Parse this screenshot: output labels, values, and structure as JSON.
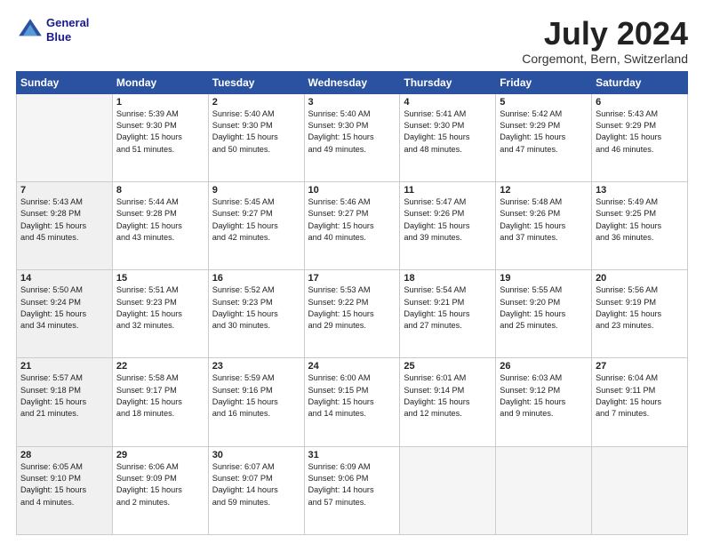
{
  "logo": {
    "line1": "General",
    "line2": "Blue"
  },
  "title": "July 2024",
  "subtitle": "Corgemont, Bern, Switzerland",
  "days_of_week": [
    "Sunday",
    "Monday",
    "Tuesday",
    "Wednesday",
    "Thursday",
    "Friday",
    "Saturday"
  ],
  "weeks": [
    [
      {
        "day": "",
        "info": "",
        "empty": true
      },
      {
        "day": "1",
        "info": "Sunrise: 5:39 AM\nSunset: 9:30 PM\nDaylight: 15 hours\nand 51 minutes."
      },
      {
        "day": "2",
        "info": "Sunrise: 5:40 AM\nSunset: 9:30 PM\nDaylight: 15 hours\nand 50 minutes."
      },
      {
        "day": "3",
        "info": "Sunrise: 5:40 AM\nSunset: 9:30 PM\nDaylight: 15 hours\nand 49 minutes."
      },
      {
        "day": "4",
        "info": "Sunrise: 5:41 AM\nSunset: 9:30 PM\nDaylight: 15 hours\nand 48 minutes."
      },
      {
        "day": "5",
        "info": "Sunrise: 5:42 AM\nSunset: 9:29 PM\nDaylight: 15 hours\nand 47 minutes."
      },
      {
        "day": "6",
        "info": "Sunrise: 5:43 AM\nSunset: 9:29 PM\nDaylight: 15 hours\nand 46 minutes."
      }
    ],
    [
      {
        "day": "7",
        "info": "Sunrise: 5:43 AM\nSunset: 9:28 PM\nDaylight: 15 hours\nand 45 minutes.",
        "shade": true
      },
      {
        "day": "8",
        "info": "Sunrise: 5:44 AM\nSunset: 9:28 PM\nDaylight: 15 hours\nand 43 minutes."
      },
      {
        "day": "9",
        "info": "Sunrise: 5:45 AM\nSunset: 9:27 PM\nDaylight: 15 hours\nand 42 minutes."
      },
      {
        "day": "10",
        "info": "Sunrise: 5:46 AM\nSunset: 9:27 PM\nDaylight: 15 hours\nand 40 minutes."
      },
      {
        "day": "11",
        "info": "Sunrise: 5:47 AM\nSunset: 9:26 PM\nDaylight: 15 hours\nand 39 minutes."
      },
      {
        "day": "12",
        "info": "Sunrise: 5:48 AM\nSunset: 9:26 PM\nDaylight: 15 hours\nand 37 minutes."
      },
      {
        "day": "13",
        "info": "Sunrise: 5:49 AM\nSunset: 9:25 PM\nDaylight: 15 hours\nand 36 minutes."
      }
    ],
    [
      {
        "day": "14",
        "info": "Sunrise: 5:50 AM\nSunset: 9:24 PM\nDaylight: 15 hours\nand 34 minutes.",
        "shade": true
      },
      {
        "day": "15",
        "info": "Sunrise: 5:51 AM\nSunset: 9:23 PM\nDaylight: 15 hours\nand 32 minutes."
      },
      {
        "day": "16",
        "info": "Sunrise: 5:52 AM\nSunset: 9:23 PM\nDaylight: 15 hours\nand 30 minutes."
      },
      {
        "day": "17",
        "info": "Sunrise: 5:53 AM\nSunset: 9:22 PM\nDaylight: 15 hours\nand 29 minutes."
      },
      {
        "day": "18",
        "info": "Sunrise: 5:54 AM\nSunset: 9:21 PM\nDaylight: 15 hours\nand 27 minutes."
      },
      {
        "day": "19",
        "info": "Sunrise: 5:55 AM\nSunset: 9:20 PM\nDaylight: 15 hours\nand 25 minutes."
      },
      {
        "day": "20",
        "info": "Sunrise: 5:56 AM\nSunset: 9:19 PM\nDaylight: 15 hours\nand 23 minutes."
      }
    ],
    [
      {
        "day": "21",
        "info": "Sunrise: 5:57 AM\nSunset: 9:18 PM\nDaylight: 15 hours\nand 21 minutes.",
        "shade": true
      },
      {
        "day": "22",
        "info": "Sunrise: 5:58 AM\nSunset: 9:17 PM\nDaylight: 15 hours\nand 18 minutes."
      },
      {
        "day": "23",
        "info": "Sunrise: 5:59 AM\nSunset: 9:16 PM\nDaylight: 15 hours\nand 16 minutes."
      },
      {
        "day": "24",
        "info": "Sunrise: 6:00 AM\nSunset: 9:15 PM\nDaylight: 15 hours\nand 14 minutes."
      },
      {
        "day": "25",
        "info": "Sunrise: 6:01 AM\nSunset: 9:14 PM\nDaylight: 15 hours\nand 12 minutes."
      },
      {
        "day": "26",
        "info": "Sunrise: 6:03 AM\nSunset: 9:12 PM\nDaylight: 15 hours\nand 9 minutes."
      },
      {
        "day": "27",
        "info": "Sunrise: 6:04 AM\nSunset: 9:11 PM\nDaylight: 15 hours\nand 7 minutes."
      }
    ],
    [
      {
        "day": "28",
        "info": "Sunrise: 6:05 AM\nSunset: 9:10 PM\nDaylight: 15 hours\nand 4 minutes.",
        "shade": true
      },
      {
        "day": "29",
        "info": "Sunrise: 6:06 AM\nSunset: 9:09 PM\nDaylight: 15 hours\nand 2 minutes."
      },
      {
        "day": "30",
        "info": "Sunrise: 6:07 AM\nSunset: 9:07 PM\nDaylight: 14 hours\nand 59 minutes."
      },
      {
        "day": "31",
        "info": "Sunrise: 6:09 AM\nSunset: 9:06 PM\nDaylight: 14 hours\nand 57 minutes."
      },
      {
        "day": "",
        "info": "",
        "empty": true
      },
      {
        "day": "",
        "info": "",
        "empty": true
      },
      {
        "day": "",
        "info": "",
        "empty": true
      }
    ]
  ]
}
